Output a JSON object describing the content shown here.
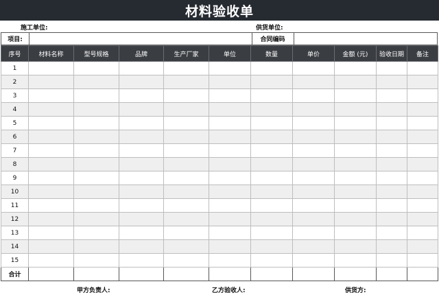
{
  "title": "材料验收单",
  "meta": {
    "construction_unit_label": "施工单位:",
    "supplier_unit_label": "供货单位:"
  },
  "project": {
    "project_label": "项目:",
    "contract_label": "合同编码"
  },
  "columns": [
    "序号",
    "材料名称",
    "型号规格",
    "品牌",
    "生产厂家",
    "单位",
    "数量",
    "单价",
    "金额 (元)",
    "验收日期",
    "备注"
  ],
  "rows": [
    "1",
    "2",
    "3",
    "4",
    "5",
    "6",
    "7",
    "8",
    "9",
    "10",
    "11",
    "12",
    "13",
    "14",
    "15"
  ],
  "total_label": "合计",
  "signatures": {
    "party_a_label": "甲方负责人:",
    "party_b_label": "乙方验收人:",
    "supplier_label": "供货方:"
  },
  "colors": {
    "title_bg": "#262a31",
    "header_bg": "#3a3d42",
    "stripe_bg": "#efefef"
  }
}
